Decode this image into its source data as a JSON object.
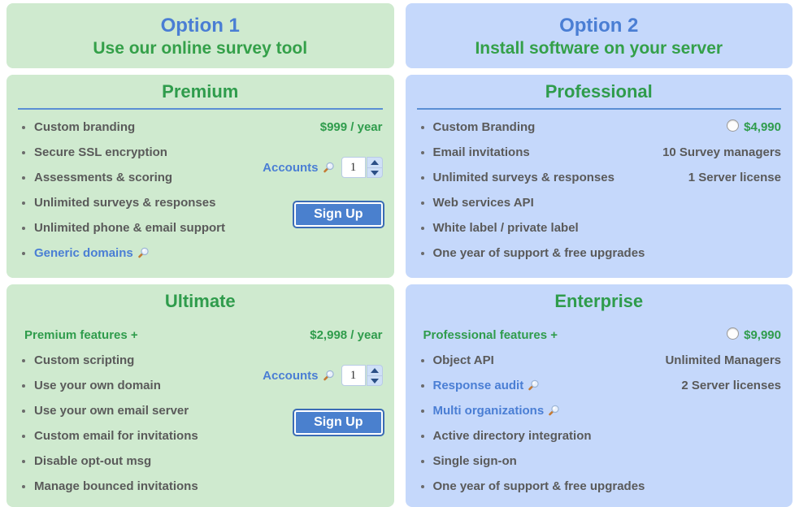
{
  "options": [
    {
      "number": "Option 1",
      "subtitle": "Use our online survey tool"
    },
    {
      "number": "Option 2",
      "subtitle": "Install software on your server"
    }
  ],
  "plans": [
    {
      "id": "premium",
      "title": "Premium",
      "theme": "green",
      "features": [
        {
          "label": "Custom branding",
          "style": "bullet"
        },
        {
          "label": "Secure SSL encryption",
          "style": "bullet"
        },
        {
          "label": "Assessments & scoring",
          "style": "bullet"
        },
        {
          "label": "Unlimited surveys & responses",
          "style": "bullet"
        },
        {
          "label": "Unlimited phone & email support",
          "style": "bullet"
        },
        {
          "label": "Generic domains",
          "style": "bullet link",
          "icon": "magnifier-icon"
        }
      ],
      "price": "$999 / year",
      "meta": [],
      "radio": false,
      "accounts": {
        "label": "Accounts",
        "icon": "magnifier-icon",
        "value": "1"
      },
      "signup_label": "Sign Up"
    },
    {
      "id": "professional",
      "title": "Professional",
      "theme": "blue",
      "features": [
        {
          "label": "Custom Branding",
          "style": "bullet"
        },
        {
          "label": "Email invitations",
          "style": "bullet"
        },
        {
          "label": "Unlimited surveys & responses",
          "style": "bullet"
        },
        {
          "label": "Web services API",
          "style": "bullet"
        },
        {
          "label": "White label / private label",
          "style": "bullet"
        },
        {
          "label": "One year of support & free upgrades",
          "style": "bullet"
        }
      ],
      "price": "$4,990",
      "meta": [
        "10 Survey managers",
        "1 Server license"
      ],
      "radio": true,
      "accounts": null,
      "signup_label": null
    },
    {
      "id": "ultimate",
      "title": "Ultimate",
      "theme": "green",
      "features": [
        {
          "label": "Premium features +",
          "style": "plain"
        },
        {
          "label": "Custom scripting",
          "style": "bullet"
        },
        {
          "label": "Use your own domain",
          "style": "bullet"
        },
        {
          "label": "Use your own email server",
          "style": "bullet"
        },
        {
          "label": "Custom email for invitations",
          "style": "bullet"
        },
        {
          "label": "Disable opt-out msg",
          "style": "bullet"
        },
        {
          "label": "Manage bounced invitations",
          "style": "bullet"
        }
      ],
      "price": "$2,998 / year",
      "meta": [],
      "radio": false,
      "accounts": {
        "label": "Accounts",
        "icon": "magnifier-icon",
        "value": "1"
      },
      "signup_label": "Sign Up"
    },
    {
      "id": "enterprise",
      "title": "Enterprise",
      "theme": "blue",
      "features": [
        {
          "label": "Professional features +",
          "style": "plain"
        },
        {
          "label": "Object API",
          "style": "bullet"
        },
        {
          "label": "Response audit",
          "style": "bullet link",
          "icon": "magnifier-icon"
        },
        {
          "label": "Multi organizations",
          "style": "bullet link",
          "icon": "magnifier-icon"
        },
        {
          "label": "Active directory integration",
          "style": "bullet"
        },
        {
          "label": "Single sign-on",
          "style": "bullet"
        },
        {
          "label": "One year of support & free upgrades",
          "style": "bullet"
        }
      ],
      "price": "$9,990",
      "meta": [
        "Unlimited Managers",
        "2 Server licenses"
      ],
      "radio": true,
      "accounts": null,
      "signup_label": null
    }
  ],
  "colors": {
    "green_panel": "#cfeacf",
    "blue_panel": "#c5d8fb",
    "title_green": "#2f9c4c",
    "option_blue": "#4a7ed4",
    "rule_blue": "#5b8fd4",
    "feature_gray": "#5a5a5a",
    "button_blue": "#4a80ce"
  }
}
